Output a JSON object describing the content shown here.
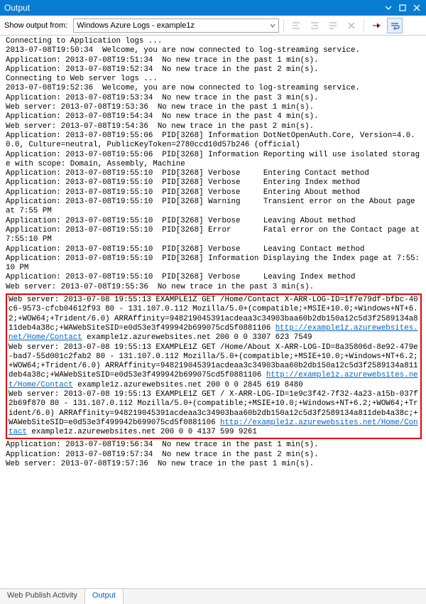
{
  "window": {
    "title": "Output"
  },
  "toolbar": {
    "label": "Show output from:",
    "dropdown_value": "Windows Azure Logs - example1z"
  },
  "log": {
    "pre_lines": [
      "Connecting to Application logs ...",
      "2013-07-08T19:50:34  Welcome, you are now connected to log-streaming service.",
      "Application: 2013-07-08T19:51:34  No new trace in the past 1 min(s).",
      "Application: 2013-07-08T19:52:34  No new trace in the past 2 min(s).",
      "Connecting to Web server logs ...",
      "2013-07-08T19:52:36  Welcome, you are now connected to log-streaming service.",
      "Application: 2013-07-08T19:53:34  No new trace in the past 3 min(s).",
      "Web server: 2013-07-08T19:53:36  No new trace in the past 1 min(s).",
      "Application: 2013-07-08T19:54:34  No new trace in the past 4 min(s).",
      "Web server: 2013-07-08T19:54:36  No new trace in the past 2 min(s).",
      "Application: 2013-07-08T19:55:06  PID[3268] Information DotNetOpenAuth.Core, Version=4.0.0.0, Culture=neutral, PublicKeyToken=2780ccd10d57b246 (official)",
      "Application: 2013-07-08T19:55:06  PID[3268] Information Reporting will use isolated storage with scope: Domain, Assembly, Machine",
      "Application: 2013-07-08T19:55:10  PID[3268] Verbose     Entering Contact method",
      "Application: 2013-07-08T19:55:10  PID[3268] Verbose     Entering Index method",
      "Application: 2013-07-08T19:55:10  PID[3268] Verbose     Entering About method",
      "Application: 2013-07-08T19:55:10  PID[3268] Warning     Transient error on the About page at 7:55 PM",
      "Application: 2013-07-08T19:55:10  PID[3268] Verbose     Leaving About method",
      "Application: 2013-07-08T19:55:10  PID[3268] Error       Fatal error on the Contact page at 7:55:10 PM",
      "Application: 2013-07-08T19:55:10  PID[3268] Verbose     Leaving Contact method",
      "Application: 2013-07-08T19:55:10  PID[3268] Information Displaying the Index page at 7:55:10 PM",
      "Application: 2013-07-08T19:55:10  PID[3268] Verbose     Leaving Index method",
      "Web server: 2013-07-08T19:55:36  No new trace in the past 3 min(s)."
    ],
    "hl": {
      "e1_pre": "Web server: 2013-07-08 19:55:13 EXAMPLE1Z GET /Home/Contact X-ARR-LOG-ID=1f7e79df-bfbc-40c6-9573-cfcb04612f93 80 - 131.107.0.112 Mozilla/5.0+(compatible;+MSIE+10.0;+Windows+NT+6.2;+WOW64;+Trident/6.0) ARRAffinity=948219045391acdeaa3c34903baa60b2db150a12c5d3f2589134a811deb4a38c;+WAWebSiteSID=e0d53e3f499942b699075cd5f0881106 ",
      "e1_link1": "http://example1z.azurewebsites.net/Home/Contact",
      "e1_post": " example1z.azurewebsites.net 200 0 0 3307 623 7549",
      "e2_pre": "Web server: 2013-07-08 19:55:13 EXAMPLE1Z GET /Home/About X-ARR-LOG-ID=8a35806d-8e92-479e-bad7-55d001c2fab2 80 - 131.107.0.112 Mozilla/5.0+(compatible;+MSIE+10.0;+Windows+NT+6.2;+WOW64;+Trident/6.0) ARRAffinity=948219045391acdeaa3c34903baa60b2db150a12c5d3f2589134a811deb4a38c;+WAWebSiteSID=e0d53e3f499942b699075cd5f0881106 ",
      "e2_link1": "http://example1z.azurewebsites.net/Home/Contact",
      "e2_post": " example1z.azurewebsites.net 200 0 0 2845 619 8480",
      "e3_pre": "Web server: 2013-07-08 19:55:13 EXAMPLE1Z GET / X-ARR-LOG-ID=1e9c3f42-7f32-4a23-a15b-037f2b69f870 80 - 131.107.0.112 Mozilla/5.0+(compatible;+MSIE+10.0;+Windows+NT+6.2;+WOW64;+Trident/6.0) ARRAffinity=948219045391acdeaa3c34903baa60b2db150a12c5d3f2589134a811deb4a38c;+WAWebSiteSID=e0d53e3f499942b699075cd5f0881106 ",
      "e3_link1": "http://example1z.azurewebsites.net/Home/Contact",
      "e3_post": " example1z.azurewebsites.net 200 0 0 4137 599 9261"
    },
    "post_lines": [
      "Application: 2013-07-08T19:56:34  No new trace in the past 1 min(s).",
      "Application: 2013-07-08T19:57:34  No new trace in the past 2 min(s).",
      "Web server: 2013-07-08T19:57:36  No new trace in the past 1 min(s).",
      ""
    ]
  },
  "tabs": {
    "t1": "Web Publish Activity",
    "t2": "Output"
  }
}
